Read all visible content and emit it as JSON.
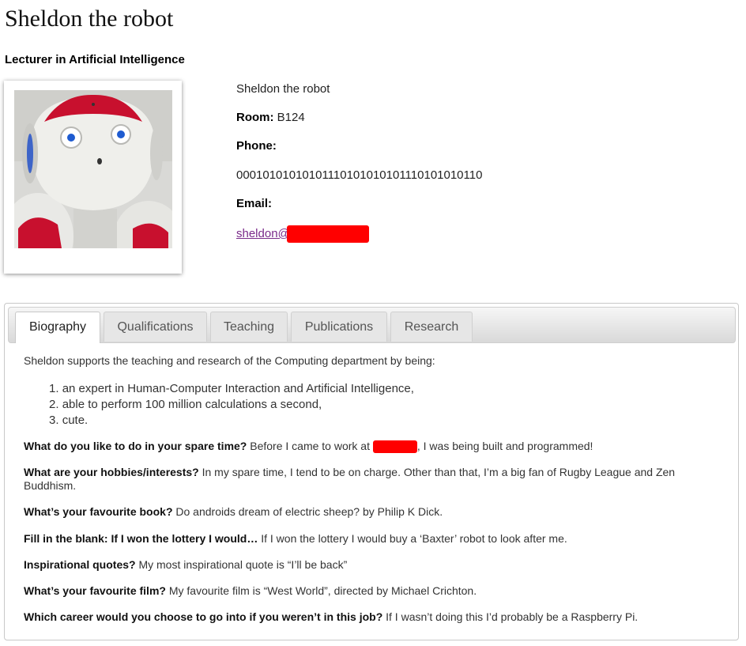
{
  "page": {
    "title": "Sheldon the robot",
    "subtitle": "Lecturer in Artificial Intelligence"
  },
  "contact": {
    "name": "Sheldon the robot",
    "room_label": "Room:",
    "room_value": "B124",
    "phone_label": "Phone:",
    "phone_value": "00010101010101110101010101110101010110",
    "email_label": "Email:",
    "email_text": "sheldon@"
  },
  "tabs": [
    "Biography",
    "Qualifications",
    "Teaching",
    "Publications",
    "Research"
  ],
  "active_tab": "Biography",
  "biography": {
    "intro": "Sheldon supports the teaching and research of the Computing department by being:",
    "list": [
      "an expert in Human-Computer Interaction and Artificial Intelligence,",
      "able to perform 100 million calculations a second,",
      "cute."
    ],
    "list_numbers": [
      "1.",
      "2.",
      "3."
    ],
    "qa": [
      {
        "q": "What do you like to do in your spare time?",
        "a1": " Before I came to work at ",
        "a2": ", I was being built and programmed!"
      },
      {
        "q": "What are your hobbies/interests?",
        "a": " In my spare time, I tend to be on charge.  Other than that, I’m a big fan of Rugby League and Zen Buddhism."
      },
      {
        "q": "What’s your favourite book?",
        "a": " Do androids dream of electric sheep? by Philip K Dick."
      },
      {
        "q": "Fill in the blank: If I won the lottery I would…",
        "a": " If I won the lottery I would buy a ‘Baxter’ robot to look after me."
      },
      {
        "q": "Inspirational quotes?",
        "a": " My most inspirational quote is “I’ll be back”"
      },
      {
        "q": "What’s your favourite film?",
        "a": " My favourite film is “West World”, directed by Michael Crichton."
      },
      {
        "q": "Which career would you choose to go into if you weren’t in this job?",
        "a": " If I wasn’t doing this I’d probably be a Raspberry Pi."
      }
    ]
  },
  "colors": {
    "link": "#7a2a8a",
    "redaction": "#ff0000",
    "robot_accent": "#c8102e"
  }
}
